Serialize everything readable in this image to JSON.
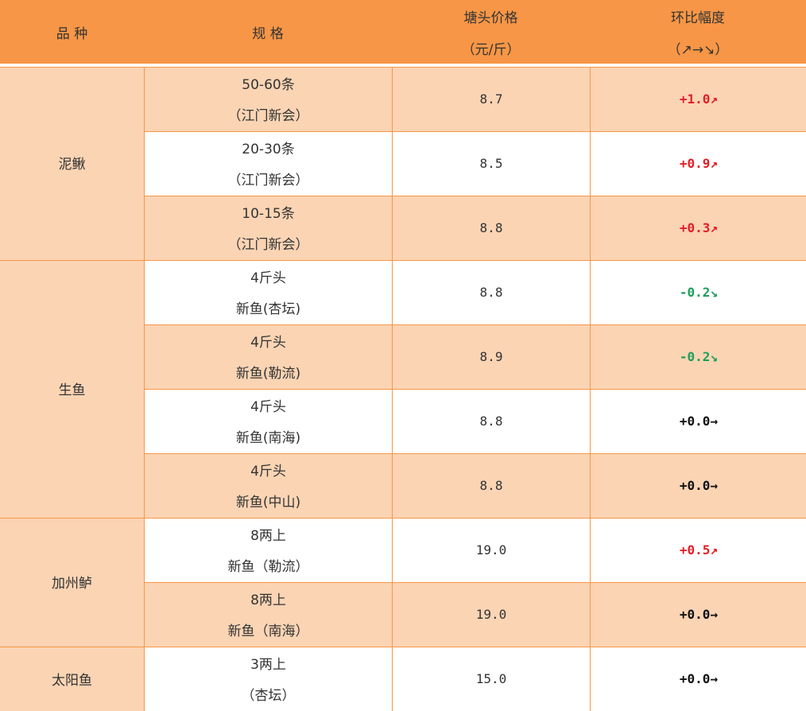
{
  "header": {
    "variety": "品  种",
    "spec": "规  格",
    "price_line1": "塘头价格",
    "price_line2": "（元/斤）",
    "change_line1": "环比幅度",
    "change_line2": "（↗→↘）"
  },
  "categories": [
    {
      "name": "泥鳅"
    },
    {
      "name": "生鱼"
    },
    {
      "name": "加州鲈"
    },
    {
      "name": "太阳鱼"
    }
  ],
  "rows": [
    {
      "spec1": "50-60条",
      "spec2": "（江门新会）",
      "price": "8.7",
      "change": "+1.0↗",
      "trend": "up"
    },
    {
      "spec1": "20-30条",
      "spec2": "（江门新会）",
      "price": "8.5",
      "change": "+0.9↗",
      "trend": "up"
    },
    {
      "spec1": "10-15条",
      "spec2": "（江门新会）",
      "price": "8.8",
      "change": "+0.3↗",
      "trend": "up"
    },
    {
      "spec1": "4斤头",
      "spec2": "新鱼(杏坛)",
      "price": "8.8",
      "change": "-0.2↘",
      "trend": "down"
    },
    {
      "spec1": "4斤头",
      "spec2": "新鱼(勒流)",
      "price": "8.9",
      "change": "-0.2↘",
      "trend": "down"
    },
    {
      "spec1": "4斤头",
      "spec2": "新鱼(南海)",
      "price": "8.8",
      "change": "+0.0→",
      "trend": "flat"
    },
    {
      "spec1": "4斤头",
      "spec2": "新鱼(中山)",
      "price": "8.8",
      "change": "+0.0→",
      "trend": "flat"
    },
    {
      "spec1": "8两上",
      "spec2": "新鱼（勒流）",
      "price": "19.0",
      "change": "+0.5↗",
      "trend": "up"
    },
    {
      "spec1": "8两上",
      "spec2": "新鱼（南海）",
      "price": "19.0",
      "change": "+0.0→",
      "trend": "flat"
    },
    {
      "spec1": "3两上",
      "spec2": "（杏坛）",
      "price": "15.0",
      "change": "+0.0→",
      "trend": "flat"
    }
  ],
  "colors": {
    "header_bg": "#F79646",
    "row_shade": "#FBD4B4",
    "up": "#E0202A",
    "down": "#1E9E5A",
    "flat": "#111111"
  }
}
